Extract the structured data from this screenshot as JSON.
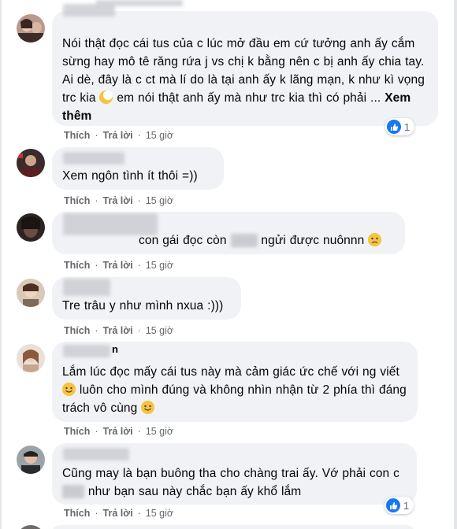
{
  "comments": [
    {
      "text_parts": [
        "Nói thật đọc cái tus của c lúc mở đầu em cứ tưởng anh ấy cắm sừng hay mô tê răng rứa j vs chị k bằng nên c bị anh ấy chia tay. Ai dè, đây là c ct mà lí do là tại anh ấy k lãng mạn, k như kì vọng trc kia",
        "em nói thật anh ấy mà như trc kia thì có phải ...",
        "Xem thêm"
      ],
      "actions": {
        "like": "Thích",
        "reply": "Trả lời",
        "time": "15 giờ"
      },
      "reaction_count": "1"
    },
    {
      "text": "Xem ngôn tình ít thôi =))",
      "actions": {
        "like": "Thích",
        "reply": "Trả lời",
        "time": "15 giờ"
      }
    },
    {
      "text_parts": [
        "con gái đọc còn",
        "ngửi được nuônnn"
      ],
      "actions": {
        "like": "Thích",
        "reply": "Trả lời",
        "time": "15 giờ"
      }
    },
    {
      "text": "Tre trâu y như mình nxua :)))",
      "actions": {
        "like": "Thích",
        "reply": "Trả lời",
        "time": "15 giờ"
      }
    },
    {
      "name_tail": "n",
      "text_parts": [
        "Lắm lúc đọc mấy cái tus này mà cảm giác ức chế với ng viết",
        "luôn cho mình đúng và không nhìn nhận từ 2 phía thì đáng trách vô cùng"
      ],
      "actions": {
        "like": "Thích",
        "reply": "Trả lời",
        "time": "15 giờ"
      }
    },
    {
      "text_parts": [
        "Cũng may là bạn buông tha cho chàng trai ấy. Vớ phải con c",
        "như bạn sau này chắc bạn ấy khổ lắm"
      ],
      "actions": {
        "like": "Thích",
        "reply": "Trả lời",
        "time": "15 giờ"
      },
      "reaction_count": "1"
    }
  ],
  "colors": {
    "bubble": "#f0f2f5",
    "meta": "#65676b",
    "like_blue": "#1877f2"
  },
  "icons": [
    "like-icon",
    "smile-emoji",
    "sad-emoji",
    "moon-emoji"
  ]
}
